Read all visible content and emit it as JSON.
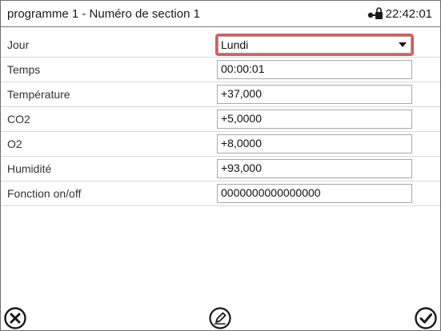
{
  "header": {
    "title": "programme 1 - Numéro de section 1",
    "time": "22:42:01",
    "lock_icon": "lock-icon"
  },
  "rows": [
    {
      "label": "Jour",
      "value": "Lundi"
    },
    {
      "label": "Temps",
      "value": "00:00:01"
    },
    {
      "label": "Température",
      "value": "+37,000"
    },
    {
      "label": "CO2",
      "value": "+5,0000"
    },
    {
      "label": "O2",
      "value": "+8,0000"
    },
    {
      "label": "Humidité",
      "value": "+93,000"
    },
    {
      "label": "Fonction on/off",
      "value": "0000000000000000"
    }
  ],
  "footer": {
    "cancel_icon": "cancel-icon",
    "edit_icon": "edit-icon",
    "confirm_icon": "confirm-icon"
  },
  "colors": {
    "highlight": "#e05a5a",
    "text": "#1a1a1a"
  }
}
